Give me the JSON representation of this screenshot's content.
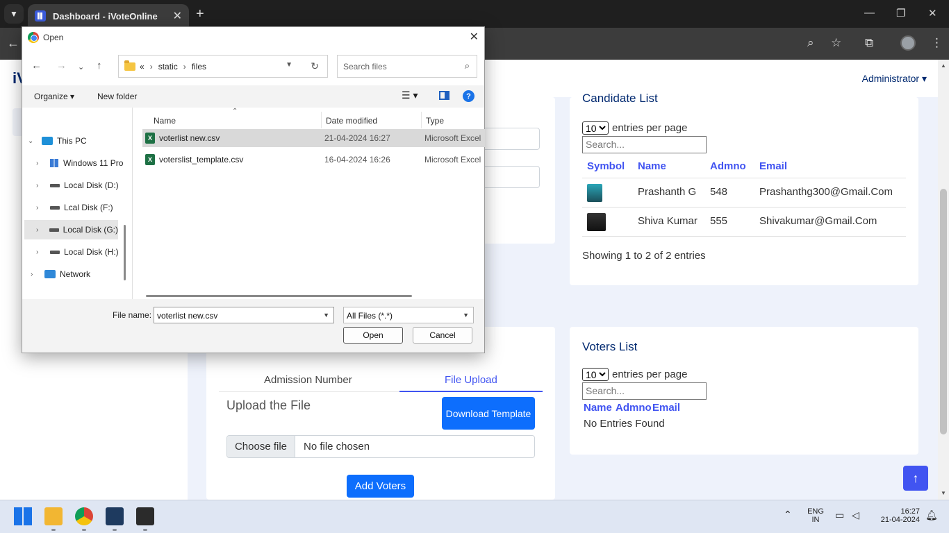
{
  "browser": {
    "tab_title": "Dashboard - iVoteOnline",
    "new_tab": "+",
    "close_tab": "✕"
  },
  "app": {
    "brand": "iV",
    "user_menu": "Administrator ▾"
  },
  "candidate_card": {
    "title": "Candidate List",
    "entries_value": "10",
    "entries_label": "entries per page",
    "search_placeholder": "Search...",
    "columns": [
      "Symbol",
      "Name",
      "Admno",
      "Email"
    ],
    "rows": [
      {
        "name": "Prashanth G",
        "admno": "548",
        "email": "Prashanthg300@Gmail.Com"
      },
      {
        "name": "Shiva Kumar",
        "admno": "555",
        "email": "Shivakumar@Gmail.Com"
      }
    ],
    "footer": "Showing 1 to 2 of 2 entries"
  },
  "voters_card": {
    "title": "Voters List",
    "entries_value": "10",
    "entries_label": "entries per page",
    "search_placeholder": "Search...",
    "columns": [
      "Name",
      "Admno",
      "Email"
    ],
    "empty": "No Entries Found"
  },
  "upload_card": {
    "tabs": [
      "Admission Number",
      "File Upload"
    ],
    "heading": "Upload the File",
    "download_btn": "Download Template",
    "choose_file": "Choose file",
    "no_file": "No file chosen",
    "add_btn": "Add Voters"
  },
  "dialog": {
    "title": "Open",
    "path": [
      "«",
      "static",
      "files"
    ],
    "search_placeholder": "Search files",
    "organize": "Organize ▾",
    "new_folder": "New folder",
    "help": "?",
    "tree": [
      {
        "label": "This PC",
        "icon": "pc"
      },
      {
        "label": "Windows 11 Pro",
        "icon": "win"
      },
      {
        "label": "Local Disk (D:)",
        "icon": "disk"
      },
      {
        "label": "Lcal Disk (F:)",
        "icon": "disk"
      },
      {
        "label": "Local Disk (G:)",
        "icon": "disk"
      },
      {
        "label": "Local Disk (H:)",
        "icon": "disk"
      },
      {
        "label": "Network",
        "icon": "net"
      }
    ],
    "columns": [
      "Name",
      "Date modified",
      "Type"
    ],
    "files": [
      {
        "name": "voterlist new.csv",
        "date": "21-04-2024 16:27",
        "type": "Microsoft Excel"
      },
      {
        "name": "voterslist_template.csv",
        "date": "16-04-2024 16:26",
        "type": "Microsoft Excel"
      }
    ],
    "file_name_label": "File name:",
    "file_name_value": "voterlist new.csv",
    "filter": "All Files (*.*)",
    "open_btn": "Open",
    "cancel_btn": "Cancel"
  },
  "taskbar": {
    "lang": "ENG",
    "region": "IN",
    "time": "16:27",
    "date": "21-04-2024"
  },
  "colors": {
    "accent": "#4154f1",
    "primary": "#0d6efd",
    "navy": "#012970"
  }
}
